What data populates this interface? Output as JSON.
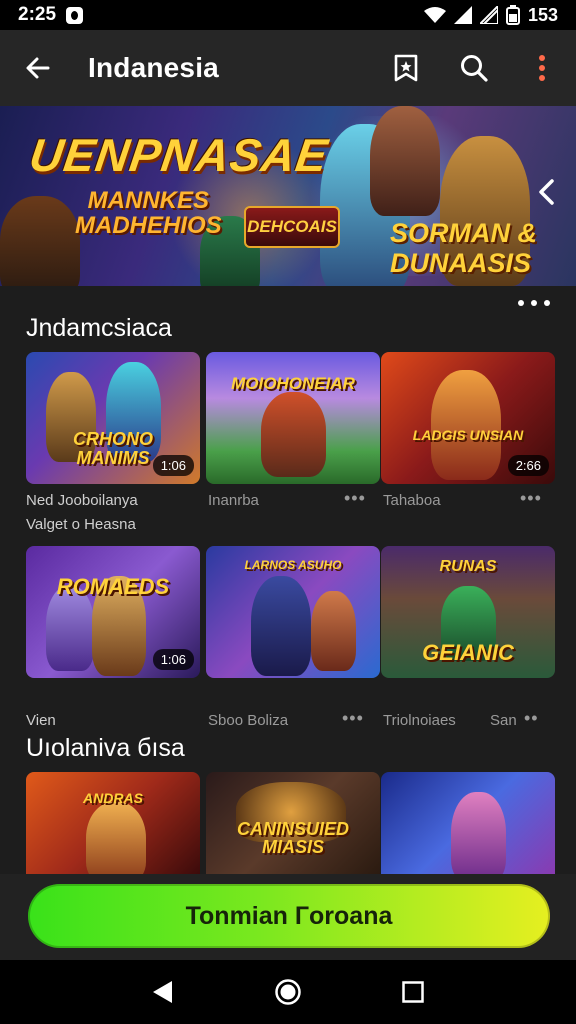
{
  "status_bar": {
    "time": "2:25",
    "battery": "153"
  },
  "app_bar": {
    "title": "Indanesia"
  },
  "banner": {
    "title": "UENPNASAE",
    "subtitle_line1": "MANNKES",
    "subtitle_line2": "MADHEHIOS",
    "badge": "DEHCOAIS",
    "right_line1": "SORMAN &",
    "right_line2": "DUNAASIS"
  },
  "section1": {
    "title": "Jndamcsiaca",
    "cards": [
      {
        "art_title": "CRHONO MANIMS",
        "badge": "1:06",
        "label": "Ned Jooboilanya",
        "sub": "Valget o Heasna"
      },
      {
        "art_title": "MOIOHONEIAR",
        "label": "Inanrba"
      },
      {
        "art_title": "LADGIS UNSIAN",
        "badge": "2:66",
        "label": "Tahaboa"
      }
    ]
  },
  "section2": {
    "cards": [
      {
        "art_title": "ROMAEDS",
        "badge": "1:06",
        "label": "Vien"
      },
      {
        "art_title": "LARNOS ASUHO",
        "label": "Sboo Boliza"
      },
      {
        "art_title": "GEIANIC",
        "label": "Triolnoiaes",
        "label2": "San"
      }
    ]
  },
  "section3": {
    "title": "Uıolaniva бısa",
    "cards": [
      {
        "art_title": "ANDRAS"
      },
      {
        "art_title": "CANINSUIED MIASIS"
      },
      {
        "art_title": ""
      }
    ]
  },
  "cta": {
    "label": "Tonmian Гoroana"
  },
  "colors": {
    "accent_start": "#39e21a",
    "accent_end": "#e6ef20",
    "background": "#1d1d1d"
  }
}
